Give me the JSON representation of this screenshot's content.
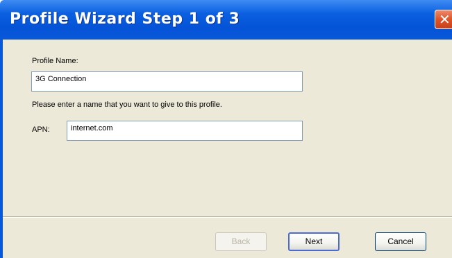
{
  "window": {
    "title": "Profile Wizard Step 1 of 3",
    "close_glyph": "✕"
  },
  "form": {
    "profile_name_label": "Profile Name:",
    "profile_name_value": "3G Connection",
    "profile_name_hint": "Please enter a name that you want to give to this profile.",
    "apn_label": "APN:",
    "apn_value": "internet.com"
  },
  "buttons": {
    "back": "Back",
    "next": "Next",
    "cancel": "Cancel"
  },
  "colors": {
    "titlebar": "#0553d6",
    "dialog_body": "#ece9d8",
    "close_button": "#de5428"
  }
}
